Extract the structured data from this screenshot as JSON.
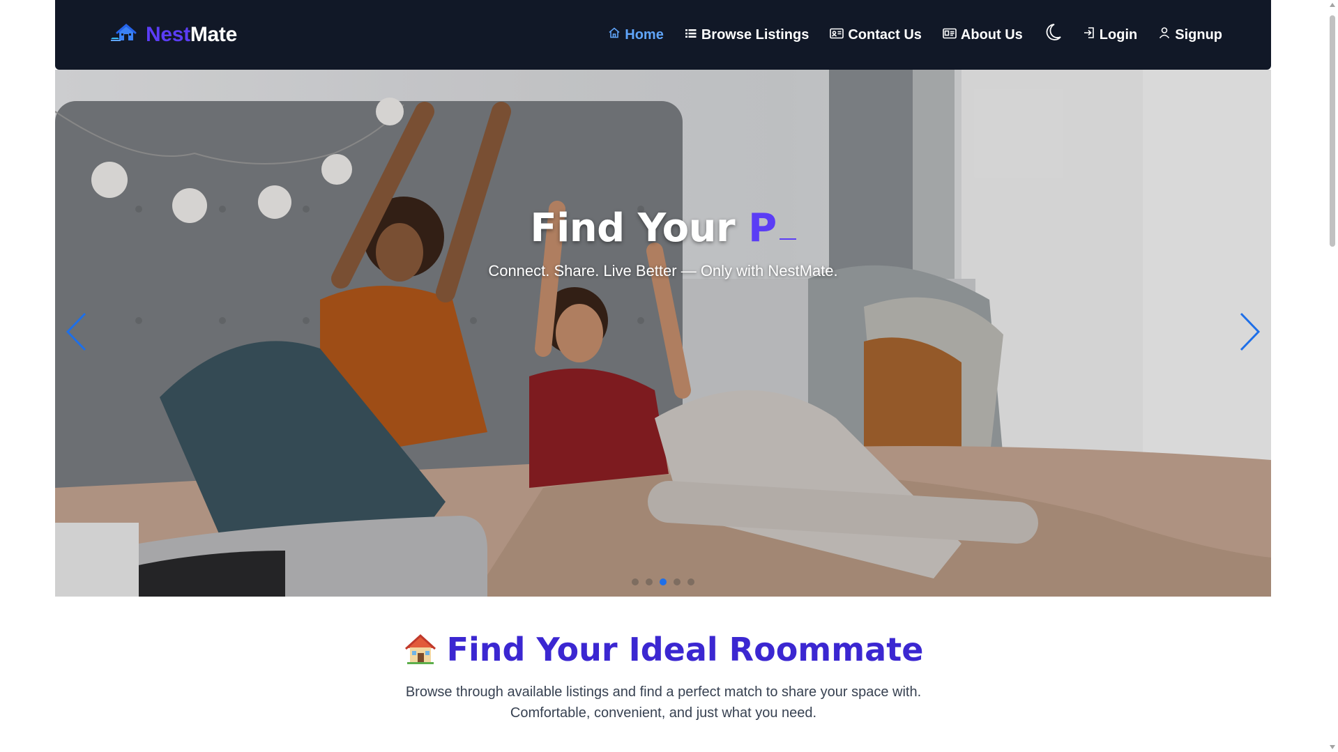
{
  "brand": {
    "part_a": "Nest",
    "part_b": "Mate",
    "icon": "house-logo-icon",
    "accent_color": "#5b3df5"
  },
  "nav": {
    "items": [
      {
        "label": "Home",
        "icon": "house-icon",
        "active": true
      },
      {
        "label": "Browse Listings",
        "icon": "list-icon",
        "active": false
      },
      {
        "label": "Contact Us",
        "icon": "contact-card-icon",
        "active": false
      },
      {
        "label": "About Us",
        "icon": "id-card-icon",
        "active": false
      }
    ],
    "theme_toggle_icon": "moon-icon",
    "login_label": "Login",
    "login_icon": "sign-in-icon",
    "signup_label": "Signup",
    "signup_icon": "person-icon",
    "background": "#111827",
    "active_color": "#60a5fa"
  },
  "hero": {
    "title_static": "Find Your",
    "title_typed": "P",
    "subtitle": "Connect. Share. Live Better — Only with NestMate.",
    "slide_count": 5,
    "active_slide": 3,
    "prev_icon": "chevron-left-icon",
    "next_icon": "chevron-right-icon"
  },
  "section": {
    "emoji": "🏠",
    "title": "Find Your Ideal Roommate",
    "desc_line1": "Browse through available listings and find a perfect match to share your space with.",
    "desc_line2": "Comfortable, convenient, and just what you need.",
    "title_color": "#3b27d1"
  }
}
